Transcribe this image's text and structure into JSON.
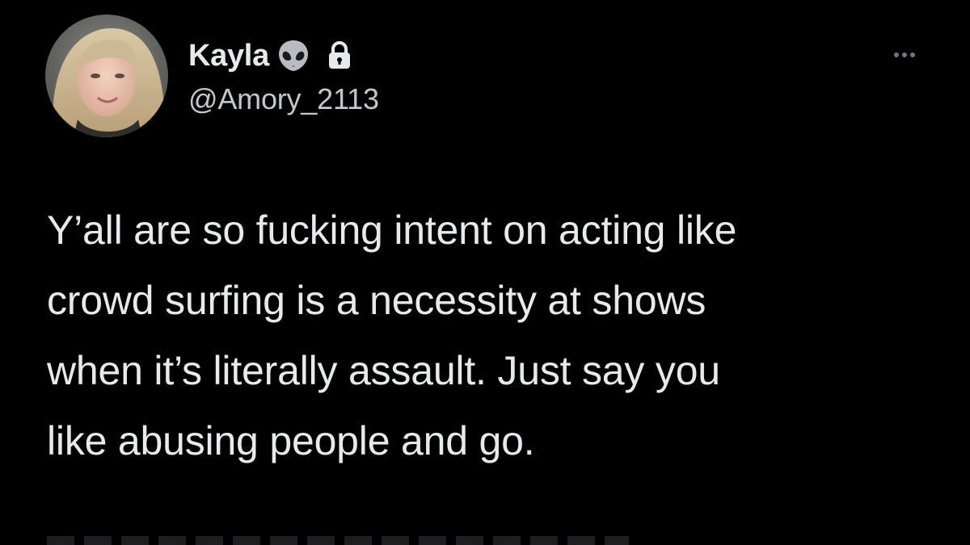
{
  "user": {
    "display_name": "Kayla",
    "name_emoji": "alien-icon",
    "protected_icon": "lock-icon",
    "handle": "@Amory_2113"
  },
  "menu": {
    "more_icon": "more-horizontal-icon"
  },
  "tweet": {
    "text": "Y’all are so fucking intent on acting like\ncrowd surfing is a necessity at shows\nwhen it’s literally assault. Just say you\nlike abusing people and go."
  },
  "colors": {
    "background": "#000000",
    "primary_text": "#e7e9ea",
    "secondary_text": "#c4c7ca",
    "icon_gray": "#71767b"
  }
}
